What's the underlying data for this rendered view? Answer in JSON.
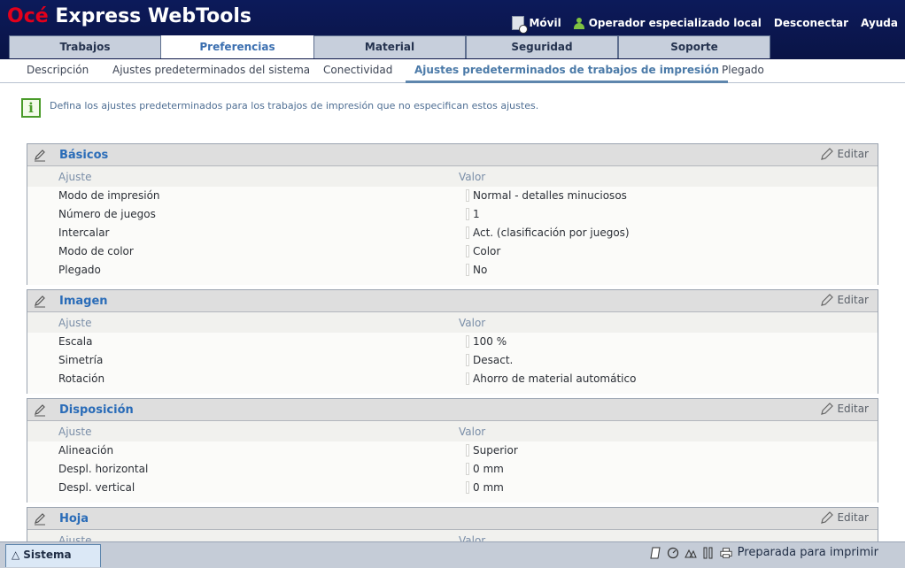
{
  "header": {
    "logo_brand": "Océ",
    "logo_product": "Express WebTools",
    "mobile_label": "Móvil",
    "user_label": "Operador especializado local",
    "logout_label": "Desconectar",
    "help_label": "Ayuda"
  },
  "main_tabs": [
    "Trabajos",
    "Preferencias",
    "Material",
    "Seguridad",
    "Soporte"
  ],
  "sub_tabs": [
    "Descripción",
    "Ajustes predeterminados del sistema",
    "Conectividad",
    "Ajustes predeterminados de trabajos de impresión",
    "Plegado"
  ],
  "info_text": "Defina los ajustes predeterminados para los trabajos de impresión que no especifican estos ajustes.",
  "edit_label": "Editar",
  "col_setting": "Ajuste",
  "col_value": "Valor",
  "panels": [
    {
      "title": "Básicos",
      "rows": [
        {
          "k": "Modo de impresión",
          "v": "Normal - detalles minuciosos"
        },
        {
          "k": "Número de juegos",
          "v": "1"
        },
        {
          "k": "Intercalar",
          "v": "Act. (clasificación por juegos)"
        },
        {
          "k": "Modo de color",
          "v": "Color"
        },
        {
          "k": "Plegado",
          "v": "No"
        }
      ]
    },
    {
      "title": "Imagen",
      "rows": [
        {
          "k": "Escala",
          "v": "100 %"
        },
        {
          "k": "Simetría",
          "v": "Desact."
        },
        {
          "k": "Rotación",
          "v": "Ahorro de material automático"
        }
      ]
    },
    {
      "title": "Disposición",
      "rows": [
        {
          "k": "Alineación",
          "v": "Superior"
        },
        {
          "k": "Despl. horizontal",
          "v": "0 mm"
        },
        {
          "k": "Despl. vertical",
          "v": "0 mm"
        }
      ]
    },
    {
      "title": "Hoja",
      "rows": []
    }
  ],
  "footer": {
    "system_tab": "Sistema",
    "status": "Preparada para imprimir"
  },
  "colors": {
    "header_bg": "#0a1446",
    "brand_red": "#e3001b",
    "accent_blue": "#2a6cb8"
  }
}
